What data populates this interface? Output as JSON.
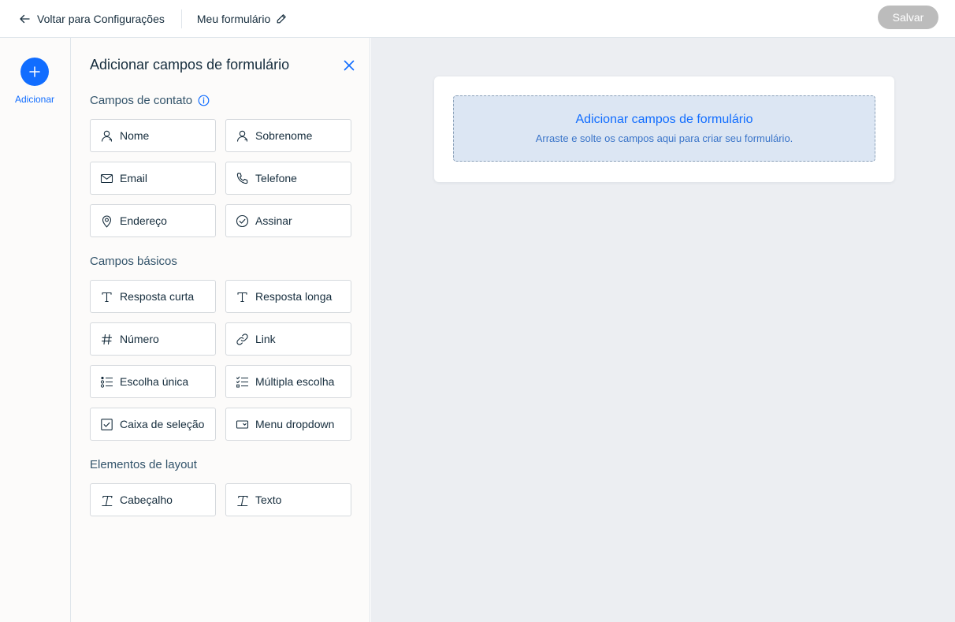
{
  "topbar": {
    "back_label": "Voltar para Configurações",
    "form_name": "Meu formulário",
    "save_label": "Salvar"
  },
  "rail": {
    "add_label": "Adicionar"
  },
  "panel": {
    "title": "Adicionar campos de formulário",
    "sections": {
      "contact": {
        "title": "Campos de contato",
        "fields": [
          {
            "label": "Nome",
            "icon": "person-icon"
          },
          {
            "label": "Sobrenome",
            "icon": "person-icon"
          },
          {
            "label": "Email",
            "icon": "envelope-icon"
          },
          {
            "label": "Telefone",
            "icon": "phone-icon"
          },
          {
            "label": "Endereço",
            "icon": "location-pin-icon"
          },
          {
            "label": "Assinar",
            "icon": "check-circle-icon"
          }
        ]
      },
      "basic": {
        "title": "Campos básicos",
        "fields": [
          {
            "label": "Resposta curta",
            "icon": "text-icon"
          },
          {
            "label": "Resposta longa",
            "icon": "text-icon"
          },
          {
            "label": "Número",
            "icon": "hash-icon"
          },
          {
            "label": "Link",
            "icon": "link-icon"
          },
          {
            "label": "Escolha única",
            "icon": "radio-list-icon"
          },
          {
            "label": "Múltipla escolha",
            "icon": "checklist-icon"
          },
          {
            "label": "Caixa de seleção",
            "icon": "checkbox-icon"
          },
          {
            "label": "Menu dropdown",
            "icon": "dropdown-icon"
          }
        ]
      },
      "layout": {
        "title": "Elementos de layout",
        "fields": [
          {
            "label": "Cabeçalho",
            "icon": "heading-icon"
          },
          {
            "label": "Texto",
            "icon": "paragraph-icon"
          }
        ]
      }
    }
  },
  "canvas": {
    "dropzone_title": "Adicionar campos de formulário",
    "dropzone_subtitle": "Arraste e solte os campos aqui para criar seu formulário."
  },
  "colors": {
    "accent": "#116dff",
    "save_disabled": "#bcbcbc",
    "canvas_bg": "#eceef2",
    "dropzone_bg": "#dce6f3"
  }
}
